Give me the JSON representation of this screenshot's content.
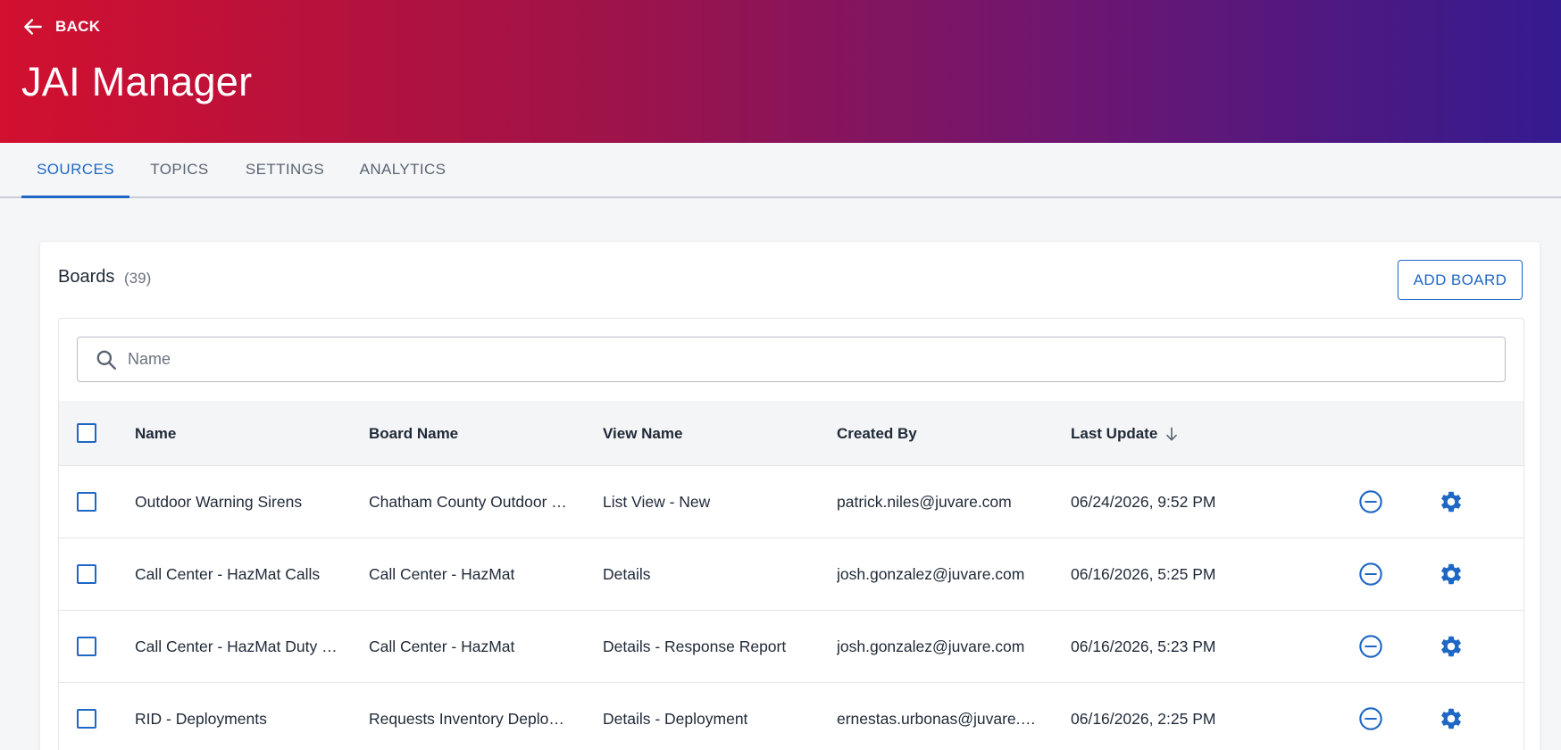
{
  "header": {
    "back_label": "BACK",
    "title": "JAI Manager"
  },
  "tabs": [
    {
      "label": "SOURCES",
      "active": true
    },
    {
      "label": "TOPICS",
      "active": false
    },
    {
      "label": "SETTINGS",
      "active": false
    },
    {
      "label": "ANALYTICS",
      "active": false
    }
  ],
  "boards": {
    "title": "Boards",
    "count": "(39)",
    "add_label": "ADD BOARD",
    "search_placeholder": "Name",
    "columns": {
      "name": "Name",
      "board_name": "Board Name",
      "view_name": "View Name",
      "created_by": "Created By",
      "last_update": "Last Update"
    },
    "rows": [
      {
        "name": "Outdoor Warning Sirens",
        "board_name": "Chatham County Outdoor …",
        "view_name": "List View - New",
        "created_by": "patrick.niles@juvare.com",
        "last_update": "06/24/2026, 9:52 PM"
      },
      {
        "name": "Call Center - HazMat Calls",
        "board_name": "Call Center - HazMat",
        "view_name": "Details",
        "created_by": "josh.gonzalez@juvare.com",
        "last_update": "06/16/2026, 5:25 PM"
      },
      {
        "name": "Call Center - HazMat Duty …",
        "board_name": "Call Center - HazMat",
        "view_name": "Details - Response Report",
        "created_by": "josh.gonzalez@juvare.com",
        "last_update": "06/16/2026, 5:23 PM"
      },
      {
        "name": "RID - Deployments",
        "board_name": "Requests Inventory Deplo…",
        "view_name": "Details - Deployment",
        "created_by": "ernestas.urbonas@juvare.…",
        "last_update": "06/16/2026, 2:25 PM"
      }
    ]
  },
  "colors": {
    "accent": "#1f67c4",
    "header_gradient_start": "#d2102f",
    "header_gradient_end": "#341b90"
  },
  "icons": {
    "back": "arrow-left-icon",
    "search": "search-icon",
    "sort": "arrow-down-icon",
    "remove": "minus-circle-icon",
    "settings": "gear-icon"
  }
}
